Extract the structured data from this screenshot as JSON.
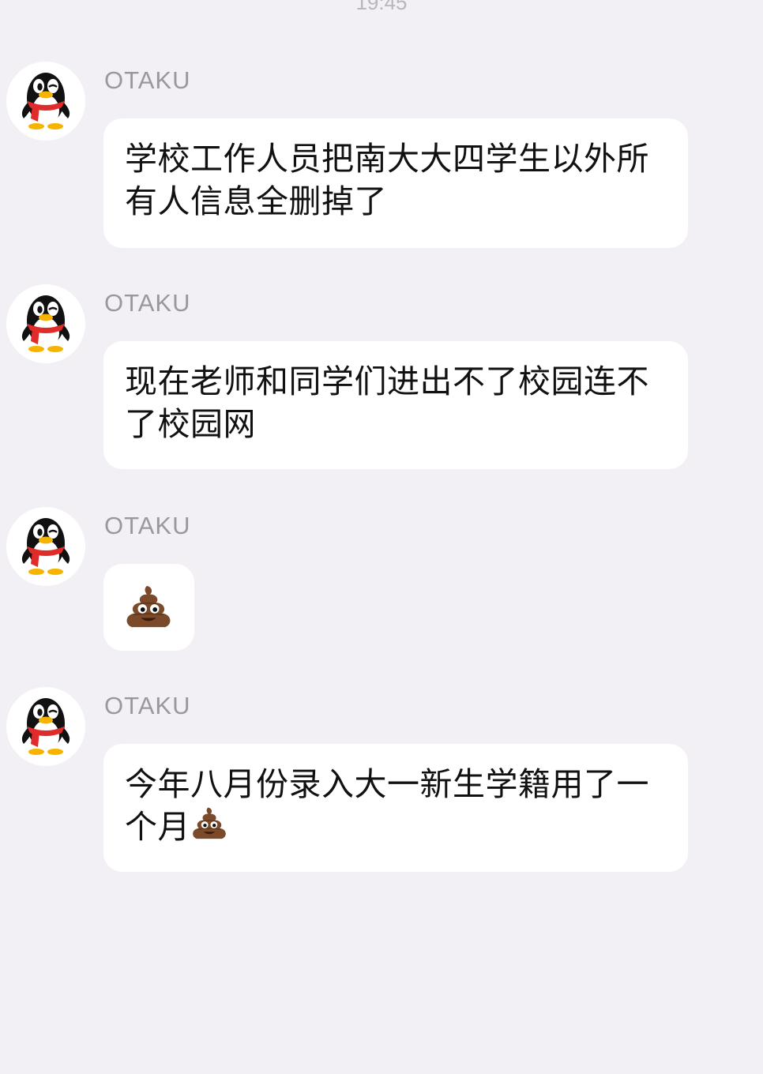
{
  "status_bar": {
    "time": "19:45"
  },
  "messages": [
    {
      "sender": "OTAKU",
      "text": "学校工作人员把南大大四学生以外所有人信息全删掉了"
    },
    {
      "sender": "OTAKU",
      "text": "现在老师和同学们进出不了校园连不了校园网"
    },
    {
      "sender": "OTAKU",
      "emoji": "pile-of-poo"
    },
    {
      "sender": "OTAKU",
      "text": "今年八月份录入大一新生学籍用了一个月",
      "trailing_emoji": "pile-of-poo"
    }
  ]
}
